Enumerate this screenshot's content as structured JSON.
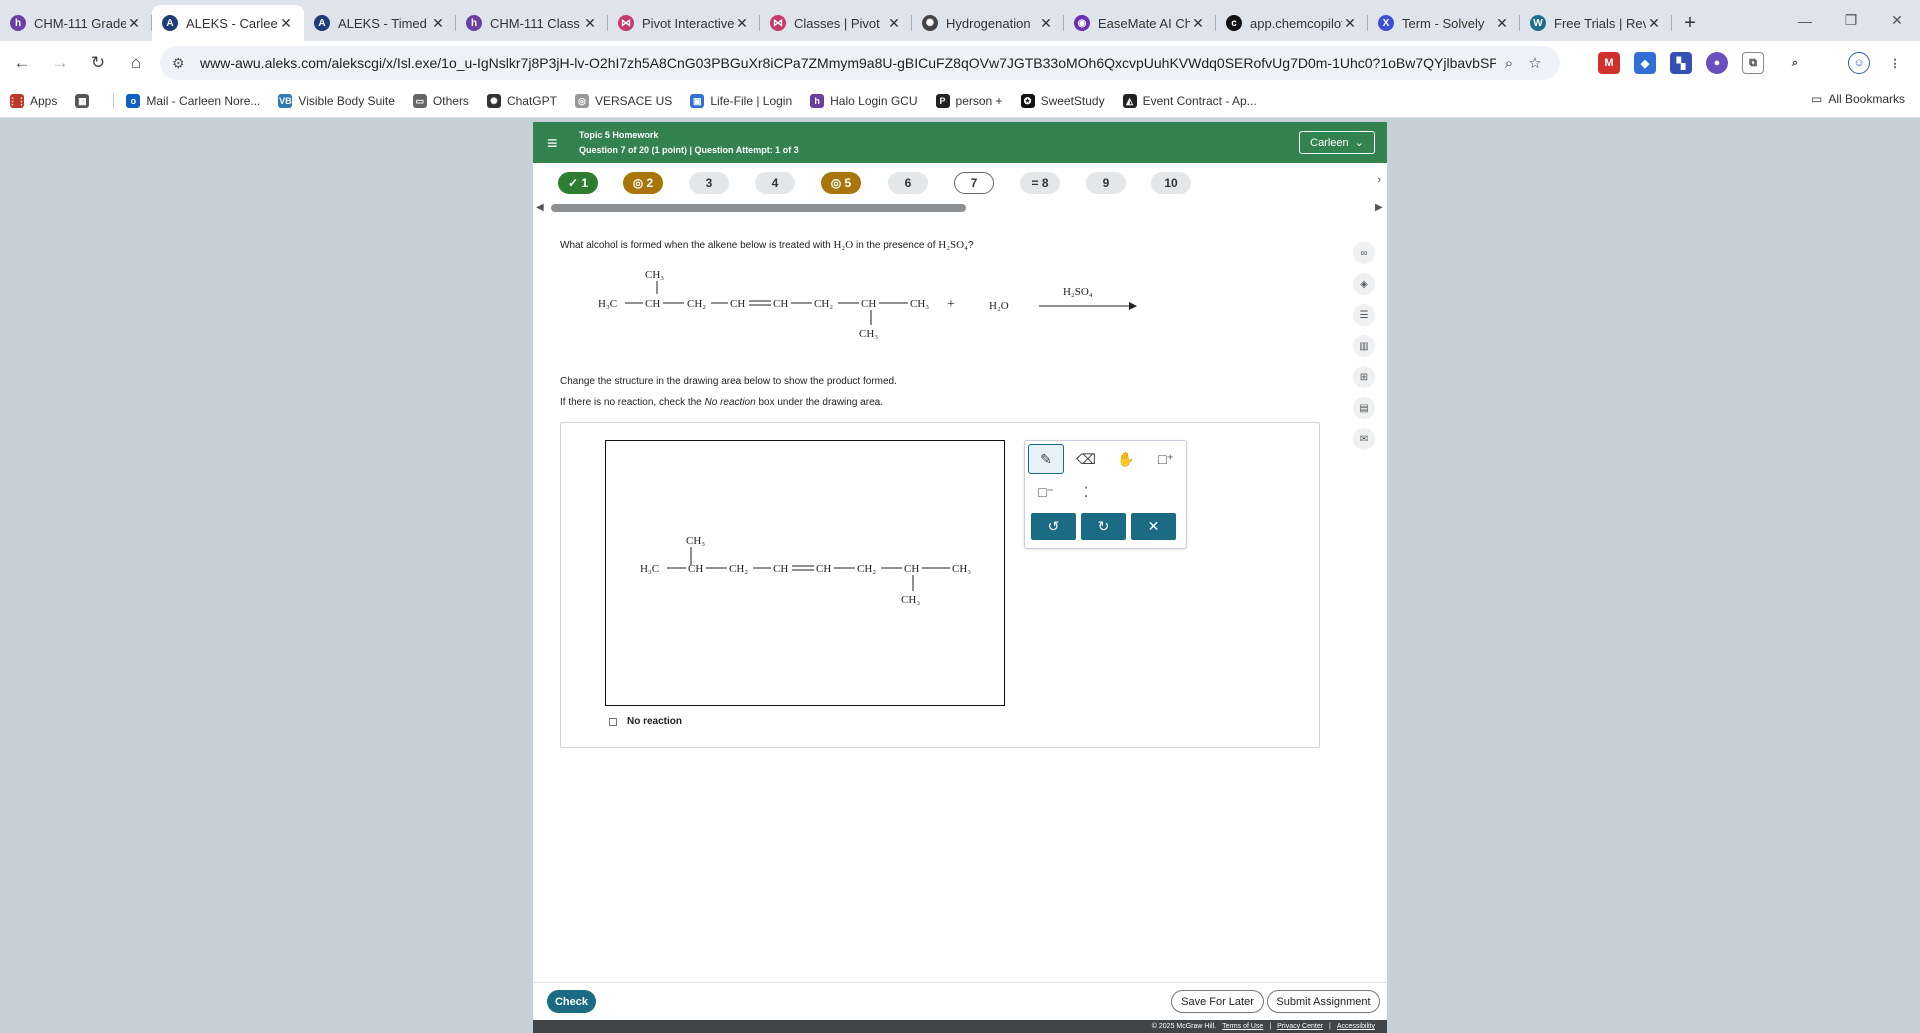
{
  "browser": {
    "tabs": [
      {
        "title": "CHM-111 Grade",
        "fav": "h",
        "color": "#6a3fa0"
      },
      {
        "title": "ALEKS - Carleen",
        "fav": "A",
        "color": "#1f3d7a",
        "active": true
      },
      {
        "title": "ALEKS - Timed",
        "fav": "A",
        "color": "#1f3d7a"
      },
      {
        "title": "CHM-111 Class",
        "fav": "h",
        "color": "#6a3fa0"
      },
      {
        "title": "Pivot Interactive",
        "fav": "⋈",
        "color": "#c63a6a"
      },
      {
        "title": "Classes | Pivot",
        "fav": "⋈",
        "color": "#c63a6a"
      },
      {
        "title": "Hydrogenation",
        "fav": "✺",
        "color": "#444"
      },
      {
        "title": "EaseMate AI Ch",
        "fav": "◉",
        "color": "#6b2fb3"
      },
      {
        "title": "app.chemcopilot",
        "fav": "c",
        "color": "#111"
      },
      {
        "title": "Term - Solvely",
        "fav": "X",
        "color": "#3b4fd6"
      },
      {
        "title": "Free Trials | Rev",
        "fav": "W",
        "color": "#1e6f8e"
      }
    ],
    "url": "www-awu.aleks.com/alekscgi/x/Isl.exe/1o_u-IgNslkr7j8P3jH-lv-O2hI7zh5A8CnG03PBGuXr8iCPa7ZMmym9a8U-gBICuFZ8qOVw7JGTB33oMOh6QxcvpUuhKVWdq0SERofvUg7D0m-1Uhc0?1oBw7QYjlbavbSPXtx-YCjs...",
    "bookmarks": [
      {
        "label": "Apps",
        "color": "#c0392b",
        "icon": "⋮⋮"
      },
      {
        "label": "",
        "color": "#555",
        "icon": "▦"
      },
      {
        "label": "Mail - Carleen Nore...",
        "color": "#0b62c4",
        "icon": "o"
      },
      {
        "label": "Visible Body Suite",
        "color": "#2c7bb6",
        "icon": "VB"
      },
      {
        "label": "Others",
        "color": "#666",
        "icon": "▭"
      },
      {
        "label": "ChatGPT",
        "color": "#333",
        "icon": "✺"
      },
      {
        "label": "VERSACE US",
        "color": "#999",
        "icon": "◎"
      },
      {
        "label": "Life-File | Login",
        "color": "#2f6fd6",
        "icon": "▣"
      },
      {
        "label": "Halo Login GCU",
        "color": "#6a3fa0",
        "icon": "h"
      },
      {
        "label": "person +",
        "color": "#222",
        "icon": "P"
      },
      {
        "label": "SweetStudy",
        "color": "#111",
        "icon": "✪"
      },
      {
        "label": "Event Contract - Ap...",
        "color": "#222",
        "icon": "◭"
      }
    ],
    "all_bookmarks": "All Bookmarks"
  },
  "aleks": {
    "topic": "Topic 5 Homework",
    "question_info": "Question 7 of 20 (1 point)  |  Question Attempt: 1 of 3",
    "user": "Carleen",
    "pills": [
      {
        "label": "✓ 1",
        "state": "done"
      },
      {
        "label": "◎ 2",
        "state": "partial"
      },
      {
        "label": "3",
        "state": ""
      },
      {
        "label": "4",
        "state": ""
      },
      {
        "label": "◎ 5",
        "state": "partial"
      },
      {
        "label": "6",
        "state": ""
      },
      {
        "label": "7",
        "state": "current"
      },
      {
        "label": "= 8",
        "state": ""
      },
      {
        "label": "9",
        "state": ""
      },
      {
        "label": "10",
        "state": ""
      }
    ],
    "question_pre": "What alcohol is formed when the alkene below is treated with ",
    "question_mid": " in the presence of ",
    "question_post": "?",
    "h2o": "H₂O",
    "h2so4": "H₂SO₄",
    "reaction": {
      "ch3": "CH₃",
      "h3c": "H₃C",
      "ch": "CH",
      "ch2": "CH₂",
      "plus": "+",
      "water": "H₂O",
      "acid": "H₂SO₄"
    },
    "instruction1": "Change the structure in the drawing area below to show the product formed.",
    "instruction2_pre": "If there is no reaction, check the ",
    "instruction2_em": "No reaction",
    "instruction2_post": " box under the drawing area.",
    "no_reaction": "No reaction",
    "check": "Check",
    "save_later": "Save For Later",
    "submit": "Submit Assignment",
    "copyright": "© 2025 McGraw Hill.",
    "terms": "Terms of Use",
    "privacy": "Privacy Center",
    "accessibility": "Accessibility"
  }
}
